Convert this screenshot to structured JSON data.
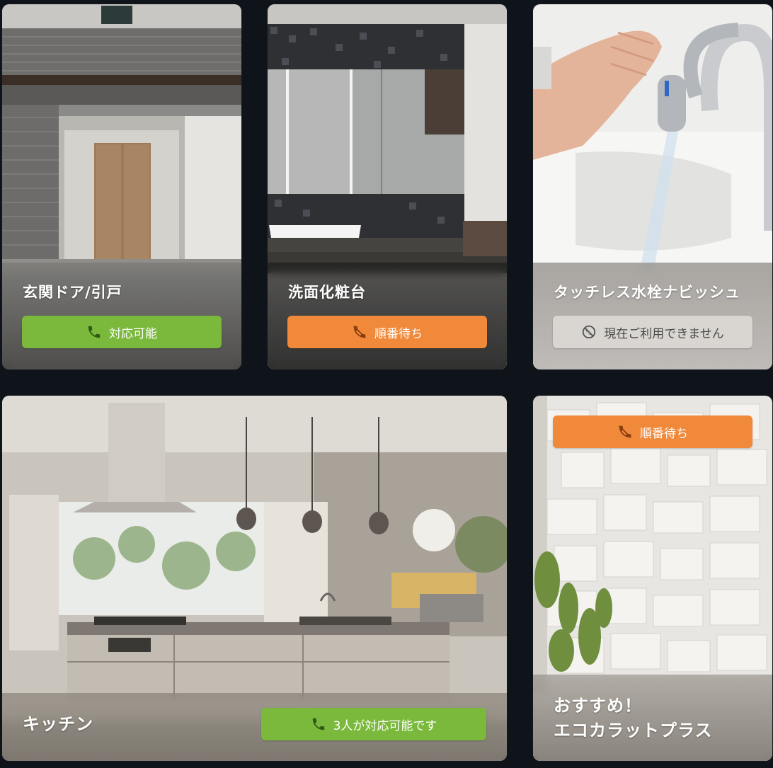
{
  "colors": {
    "background": "#0f131a",
    "available": "#7ab93b",
    "waiting": "#f0893a",
    "unavailable": "#d9d6d1"
  },
  "cards": [
    {
      "title": "玄関ドア/引戸",
      "status": "対応可能",
      "status_icon": "phone-icon"
    },
    {
      "title": "洗面化粧台",
      "status": "順番待ち",
      "status_icon": "phone-slash-icon"
    },
    {
      "title": "タッチレス水栓ナビッシュ",
      "status": "現在ご利用できません",
      "status_icon": "unavailable-icon"
    },
    {
      "title": "キッチン",
      "status": "3人が対応可能です",
      "status_icon": "phone-icon"
    },
    {
      "title_line1": "おすすめ！",
      "title_line2": "エコカラットプラス",
      "status": "順番待ち",
      "status_icon": "phone-slash-icon"
    }
  ]
}
